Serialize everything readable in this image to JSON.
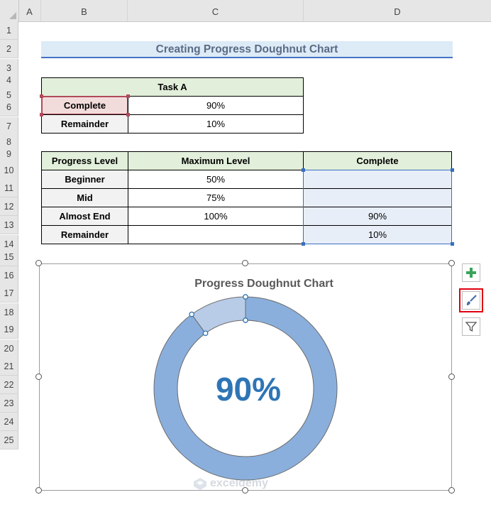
{
  "columns": [
    "A",
    "B",
    "C",
    "D"
  ],
  "rows": [
    "1",
    "2",
    "3",
    "4",
    "5",
    "6",
    "7",
    "8",
    "9",
    "10",
    "11",
    "12",
    "13",
    "14",
    "15",
    "16",
    "17",
    "18",
    "19",
    "20",
    "21",
    "22",
    "23",
    "24",
    "25"
  ],
  "sheet_title": "Creating Progress Doughnut Chart",
  "task_table": {
    "header": "Task A",
    "rows": [
      {
        "label": "Complete",
        "value": "90%"
      },
      {
        "label": "Remainder",
        "value": "10%"
      }
    ]
  },
  "progress_table": {
    "headers": [
      "Progress Level",
      "Maximum Level",
      "Complete"
    ],
    "rows": [
      {
        "level": "Beginner",
        "max": "50%",
        "complete": ""
      },
      {
        "level": "Mid",
        "max": "75%",
        "complete": ""
      },
      {
        "level": "Almost End",
        "max": "100%",
        "complete": "90%"
      },
      {
        "level": "Remainder",
        "max": "",
        "complete": "10%"
      }
    ]
  },
  "chart_data": {
    "type": "pie",
    "title": "Progress Doughnut Chart",
    "center_label": "90%",
    "slices": [
      {
        "value": 90
      },
      {
        "value": 10
      }
    ],
    "colors": [
      "#8aafdc",
      "#b8cbe7"
    ]
  },
  "chart_tools": {
    "add_element_icon": "plus-icon",
    "style_icon": "brush-icon",
    "filter_icon": "filter-icon"
  },
  "watermark": "exceldemy"
}
